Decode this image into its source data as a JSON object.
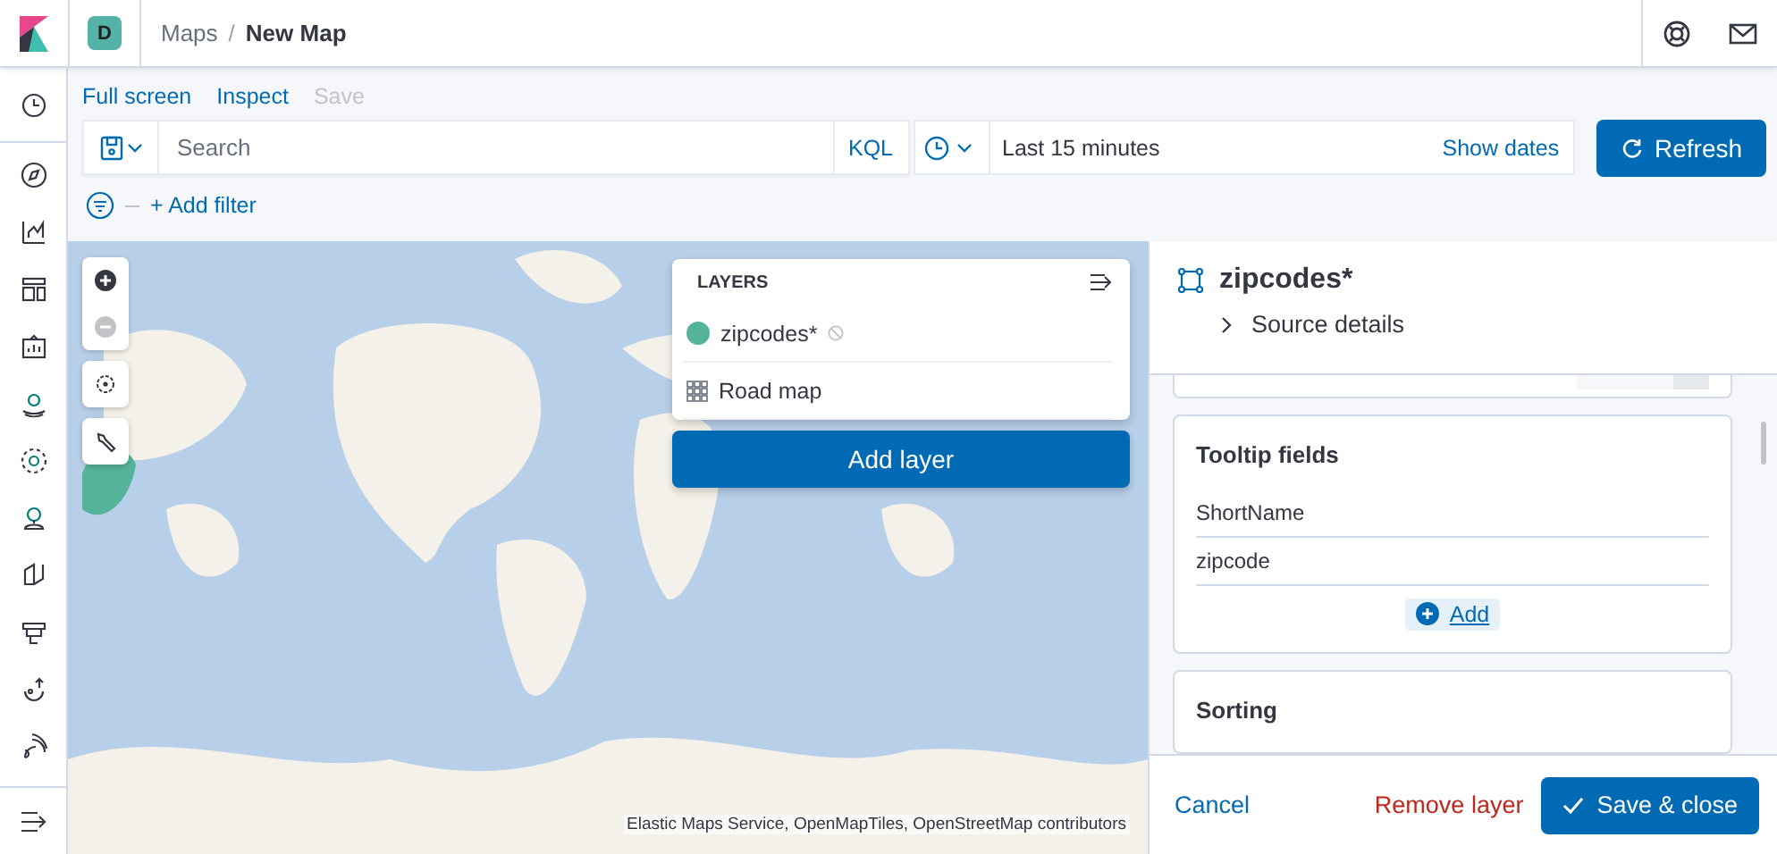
{
  "header": {
    "space_badge": "D",
    "separator": "/",
    "breadcrumbs": [
      {
        "label": "Maps",
        "selected": false
      },
      {
        "label": "New Map",
        "selected": true
      }
    ]
  },
  "top_nav": [
    {
      "label": "Full screen",
      "disabled": false
    },
    {
      "label": "Inspect",
      "disabled": false
    },
    {
      "label": "Save",
      "disabled": true
    }
  ],
  "query_bar": {
    "placeholder": "Search",
    "language": "KQL",
    "time_range": "Last 15 minutes",
    "show_dates": "Show dates",
    "refresh": "Refresh"
  },
  "filter_bar": {
    "add_filter": "+ Add filter"
  },
  "map": {
    "layers_panel": {
      "title": "LAYERS",
      "layers": [
        {
          "name": "zipcodes*",
          "kind": "vector"
        },
        {
          "name": "Road map",
          "kind": "tiles"
        }
      ],
      "add_layer": "Add layer"
    },
    "attribution": "Elastic Maps Service, OpenMapTiles, OpenStreetMap contributors"
  },
  "layer_editor": {
    "title": "zipcodes*",
    "source_details": "Source details",
    "tooltip_fields": {
      "title": "Tooltip fields",
      "fields": [
        "ShortName",
        "zipcode"
      ],
      "add": "Add"
    },
    "sorting": {
      "title": "Sorting"
    },
    "footer": {
      "cancel": "Cancel",
      "remove": "Remove layer",
      "save": "Save & close"
    }
  }
}
